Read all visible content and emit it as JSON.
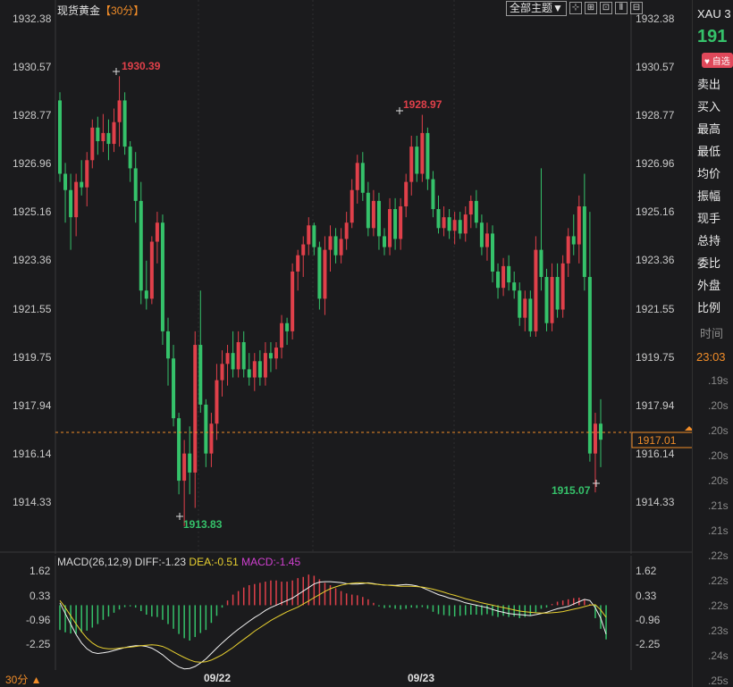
{
  "header": {
    "title": "现货黄金",
    "period": "【30分】",
    "theme_button": "全部主题▼",
    "tool_buttons": [
      "⊹",
      "⊞",
      "⊡",
      "Ⅱ",
      "⊟"
    ]
  },
  "price_axis": {
    "ticks": [
      "1932.38",
      "1930.57",
      "1928.77",
      "1926.96",
      "1925.16",
      "1923.36",
      "1921.55",
      "1919.75",
      "1917.94",
      "1916.14",
      "1914.33"
    ]
  },
  "current_price": "1917.01",
  "annotations": {
    "high1": "1930.39",
    "high2": "1928.97",
    "low1": "1913.83",
    "low2": "1915.07"
  },
  "macd": {
    "name": "MACD(26,12,9)",
    "diff": "DIFF:-1.23",
    "dea": "DEA:-0.51",
    "macd": "MACD:-1.45",
    "ticks": [
      "1.62",
      "0.33",
      "-0.96",
      "-2.25"
    ]
  },
  "x_axis": {
    "dates": [
      "09/22",
      "09/23"
    ]
  },
  "footer": {
    "period": "30分 ▲"
  },
  "sidebar": {
    "symbol": "XAU 3",
    "price": "191",
    "badge": "♥ 自选",
    "items": [
      "卖出",
      "买入",
      "最高",
      "最低",
      "均价",
      "振幅",
      "现手",
      "总持",
      "委比",
      "外盘",
      "比例"
    ],
    "time_label": "时间",
    "time_value": "23:03",
    "ticks": [
      ".19s",
      ".20s",
      ".20s",
      ".20s",
      ".20s",
      ".21s",
      ".21s",
      ".22s",
      ".22s",
      ".22s",
      ".23s",
      ".24s",
      ".25s"
    ]
  },
  "colors": {
    "up": "#e0404a",
    "down": "#35c26a",
    "background": "#1b1b1d",
    "accent": "#f08c28",
    "dea": "#e8d030",
    "macd_label": "#d040d0"
  },
  "chart_data": {
    "type": "candlestick",
    "price_range": [
      1913.2,
      1933.0
    ],
    "candles": [
      {
        "o": 1929.5,
        "h": 1929.8,
        "l": 1926.5,
        "c": 1926.8
      },
      {
        "o": 1926.8,
        "h": 1927.2,
        "l": 1925.0,
        "c": 1926.2
      },
      {
        "o": 1926.2,
        "h": 1926.8,
        "l": 1924.0,
        "c": 1925.2
      },
      {
        "o": 1925.2,
        "h": 1926.8,
        "l": 1924.5,
        "c": 1926.5
      },
      {
        "o": 1926.5,
        "h": 1927.3,
        "l": 1926.0,
        "c": 1926.3
      },
      {
        "o": 1926.3,
        "h": 1927.6,
        "l": 1925.6,
        "c": 1927.3
      },
      {
        "o": 1927.3,
        "h": 1928.8,
        "l": 1927.0,
        "c": 1928.5
      },
      {
        "o": 1928.5,
        "h": 1928.9,
        "l": 1927.5,
        "c": 1928.0
      },
      {
        "o": 1928.0,
        "h": 1929.0,
        "l": 1927.6,
        "c": 1928.3
      },
      {
        "o": 1928.3,
        "h": 1928.8,
        "l": 1927.3,
        "c": 1927.9
      },
      {
        "o": 1927.9,
        "h": 1929.2,
        "l": 1927.6,
        "c": 1928.7
      },
      {
        "o": 1928.7,
        "h": 1930.39,
        "l": 1927.8,
        "c": 1929.5
      },
      {
        "o": 1929.5,
        "h": 1929.8,
        "l": 1927.5,
        "c": 1927.8
      },
      {
        "o": 1927.8,
        "h": 1928.0,
        "l": 1926.5,
        "c": 1927.0
      },
      {
        "o": 1927.0,
        "h": 1927.6,
        "l": 1925.0,
        "c": 1925.8
      },
      {
        "o": 1925.8,
        "h": 1926.5,
        "l": 1922.0,
        "c": 1922.5
      },
      {
        "o": 1922.5,
        "h": 1923.6,
        "l": 1921.8,
        "c": 1922.2
      },
      {
        "o": 1922.2,
        "h": 1924.5,
        "l": 1922.0,
        "c": 1924.3
      },
      {
        "o": 1924.3,
        "h": 1925.4,
        "l": 1923.5,
        "c": 1925.0
      },
      {
        "o": 1925.0,
        "h": 1925.3,
        "l": 1920.5,
        "c": 1921.0
      },
      {
        "o": 1921.0,
        "h": 1921.5,
        "l": 1919.0,
        "c": 1920.0
      },
      {
        "o": 1920.0,
        "h": 1920.5,
        "l": 1917.5,
        "c": 1917.8
      },
      {
        "o": 1917.8,
        "h": 1918.0,
        "l": 1915.0,
        "c": 1915.5
      },
      {
        "o": 1915.5,
        "h": 1917.0,
        "l": 1913.83,
        "c": 1916.5
      },
      {
        "o": 1916.5,
        "h": 1917.5,
        "l": 1915.0,
        "c": 1915.8
      },
      {
        "o": 1915.8,
        "h": 1921.0,
        "l": 1914.5,
        "c": 1920.5
      },
      {
        "o": 1920.5,
        "h": 1922.5,
        "l": 1918.0,
        "c": 1918.3
      },
      {
        "o": 1918.3,
        "h": 1918.5,
        "l": 1916.0,
        "c": 1916.5
      },
      {
        "o": 1916.5,
        "h": 1918.0,
        "l": 1916.0,
        "c": 1917.6
      },
      {
        "o": 1917.6,
        "h": 1919.8,
        "l": 1917.0,
        "c": 1919.2
      },
      {
        "o": 1919.2,
        "h": 1920.3,
        "l": 1918.6,
        "c": 1919.8
      },
      {
        "o": 1919.8,
        "h": 1920.5,
        "l": 1919.0,
        "c": 1920.2
      },
      {
        "o": 1920.2,
        "h": 1921.0,
        "l": 1919.3,
        "c": 1919.6
      },
      {
        "o": 1919.6,
        "h": 1921.0,
        "l": 1919.3,
        "c": 1920.6
      },
      {
        "o": 1920.6,
        "h": 1921.0,
        "l": 1919.3,
        "c": 1919.6
      },
      {
        "o": 1919.6,
        "h": 1920.2,
        "l": 1919.0,
        "c": 1919.3
      },
      {
        "o": 1919.3,
        "h": 1920.2,
        "l": 1918.8,
        "c": 1919.9
      },
      {
        "o": 1919.9,
        "h": 1920.3,
        "l": 1919.0,
        "c": 1919.3
      },
      {
        "o": 1919.3,
        "h": 1920.6,
        "l": 1919.0,
        "c": 1920.2
      },
      {
        "o": 1920.2,
        "h": 1920.6,
        "l": 1919.5,
        "c": 1920.0
      },
      {
        "o": 1920.0,
        "h": 1920.6,
        "l": 1919.6,
        "c": 1920.4
      },
      {
        "o": 1920.4,
        "h": 1921.6,
        "l": 1920.0,
        "c": 1921.3
      },
      {
        "o": 1921.3,
        "h": 1921.5,
        "l": 1920.5,
        "c": 1921.0
      },
      {
        "o": 1921.0,
        "h": 1923.5,
        "l": 1920.7,
        "c": 1923.2
      },
      {
        "o": 1923.2,
        "h": 1924.0,
        "l": 1922.5,
        "c": 1923.8
      },
      {
        "o": 1923.8,
        "h": 1924.5,
        "l": 1923.0,
        "c": 1924.2
      },
      {
        "o": 1924.2,
        "h": 1925.2,
        "l": 1923.8,
        "c": 1924.9
      },
      {
        "o": 1924.9,
        "h": 1925.0,
        "l": 1923.8,
        "c": 1924.1
      },
      {
        "o": 1924.1,
        "h": 1924.3,
        "l": 1921.8,
        "c": 1922.2
      },
      {
        "o": 1922.2,
        "h": 1924.5,
        "l": 1921.6,
        "c": 1924.0
      },
      {
        "o": 1924.0,
        "h": 1924.9,
        "l": 1923.2,
        "c": 1924.5
      },
      {
        "o": 1924.5,
        "h": 1924.8,
        "l": 1923.5,
        "c": 1923.8
      },
      {
        "o": 1923.8,
        "h": 1924.8,
        "l": 1923.5,
        "c": 1924.4
      },
      {
        "o": 1924.4,
        "h": 1925.4,
        "l": 1924.0,
        "c": 1925.0
      },
      {
        "o": 1925.0,
        "h": 1926.6,
        "l": 1924.8,
        "c": 1926.2
      },
      {
        "o": 1926.2,
        "h": 1927.5,
        "l": 1925.7,
        "c": 1927.2
      },
      {
        "o": 1927.2,
        "h": 1927.6,
        "l": 1925.8,
        "c": 1926.1
      },
      {
        "o": 1926.1,
        "h": 1926.5,
        "l": 1924.5,
        "c": 1924.8
      },
      {
        "o": 1924.8,
        "h": 1926.2,
        "l": 1924.5,
        "c": 1925.8
      },
      {
        "o": 1925.8,
        "h": 1926.1,
        "l": 1924.0,
        "c": 1924.5
      },
      {
        "o": 1924.5,
        "h": 1924.8,
        "l": 1923.8,
        "c": 1924.1
      },
      {
        "o": 1924.1,
        "h": 1925.9,
        "l": 1923.8,
        "c": 1925.5
      },
      {
        "o": 1925.5,
        "h": 1925.9,
        "l": 1924.0,
        "c": 1924.4
      },
      {
        "o": 1924.4,
        "h": 1925.9,
        "l": 1924.0,
        "c": 1925.6
      },
      {
        "o": 1925.6,
        "h": 1926.8,
        "l": 1925.2,
        "c": 1926.5
      },
      {
        "o": 1926.5,
        "h": 1928.2,
        "l": 1926.0,
        "c": 1927.8
      },
      {
        "o": 1927.8,
        "h": 1928.2,
        "l": 1926.5,
        "c": 1926.8
      },
      {
        "o": 1926.8,
        "h": 1928.97,
        "l": 1926.5,
        "c": 1928.3
      },
      {
        "o": 1928.3,
        "h": 1928.5,
        "l": 1926.2,
        "c": 1926.6
      },
      {
        "o": 1926.6,
        "h": 1926.9,
        "l": 1925.2,
        "c": 1925.5
      },
      {
        "o": 1925.5,
        "h": 1926.0,
        "l": 1924.6,
        "c": 1924.8
      },
      {
        "o": 1924.8,
        "h": 1925.6,
        "l": 1924.5,
        "c": 1925.2
      },
      {
        "o": 1925.2,
        "h": 1925.5,
        "l": 1924.4,
        "c": 1924.7
      },
      {
        "o": 1924.7,
        "h": 1925.4,
        "l": 1924.2,
        "c": 1925.1
      },
      {
        "o": 1925.1,
        "h": 1925.4,
        "l": 1924.4,
        "c": 1924.6
      },
      {
        "o": 1924.6,
        "h": 1925.6,
        "l": 1924.3,
        "c": 1925.3
      },
      {
        "o": 1925.3,
        "h": 1926.0,
        "l": 1924.8,
        "c": 1925.8
      },
      {
        "o": 1925.8,
        "h": 1926.2,
        "l": 1924.8,
        "c": 1925.0
      },
      {
        "o": 1925.0,
        "h": 1925.3,
        "l": 1923.8,
        "c": 1924.1
      },
      {
        "o": 1924.1,
        "h": 1925.0,
        "l": 1923.6,
        "c": 1924.6
      },
      {
        "o": 1924.6,
        "h": 1924.9,
        "l": 1922.8,
        "c": 1923.2
      },
      {
        "o": 1923.2,
        "h": 1923.5,
        "l": 1922.2,
        "c": 1922.6
      },
      {
        "o": 1922.6,
        "h": 1923.7,
        "l": 1922.3,
        "c": 1923.4
      },
      {
        "o": 1923.4,
        "h": 1923.8,
        "l": 1922.5,
        "c": 1922.8
      },
      {
        "o": 1922.8,
        "h": 1923.2,
        "l": 1922.2,
        "c": 1922.5
      },
      {
        "o": 1922.5,
        "h": 1922.8,
        "l": 1921.2,
        "c": 1921.5
      },
      {
        "o": 1921.5,
        "h": 1922.5,
        "l": 1921.0,
        "c": 1922.2
      },
      {
        "o": 1922.2,
        "h": 1922.5,
        "l": 1920.8,
        "c": 1921.0
      },
      {
        "o": 1921.0,
        "h": 1924.5,
        "l": 1920.8,
        "c": 1924.0
      },
      {
        "o": 1924.0,
        "h": 1927.0,
        "l": 1922.5,
        "c": 1923.0
      },
      {
        "o": 1923.0,
        "h": 1923.3,
        "l": 1921.0,
        "c": 1921.3
      },
      {
        "o": 1921.3,
        "h": 1923.5,
        "l": 1921.0,
        "c": 1923.0
      },
      {
        "o": 1923.0,
        "h": 1923.5,
        "l": 1921.5,
        "c": 1921.8
      },
      {
        "o": 1921.8,
        "h": 1923.8,
        "l": 1921.5,
        "c": 1923.5
      },
      {
        "o": 1923.5,
        "h": 1924.8,
        "l": 1923.0,
        "c": 1924.5
      },
      {
        "o": 1924.5,
        "h": 1925.3,
        "l": 1923.8,
        "c": 1924.2
      },
      {
        "o": 1924.2,
        "h": 1926.0,
        "l": 1923.5,
        "c": 1925.6
      },
      {
        "o": 1925.6,
        "h": 1926.8,
        "l": 1922.5,
        "c": 1923.0
      },
      {
        "o": 1923.0,
        "h": 1925.4,
        "l": 1916.2,
        "c": 1916.5
      },
      {
        "o": 1916.5,
        "h": 1918.0,
        "l": 1915.07,
        "c": 1917.6
      },
      {
        "o": 1917.6,
        "h": 1918.5,
        "l": 1916.0,
        "c": 1917.01
      }
    ],
    "macd_range": [
      -2.75,
      1.95
    ],
    "macd_hist": [
      -1.05,
      -1.15,
      -1.2,
      -1.22,
      -1.15,
      -1.08,
      -0.95,
      -0.8,
      -0.62,
      -0.48,
      -0.32,
      -0.18,
      -0.08,
      -0.05,
      -0.1,
      -0.25,
      -0.4,
      -0.48,
      -0.5,
      -0.62,
      -0.8,
      -1.0,
      -1.22,
      -1.4,
      -1.5,
      -1.35,
      -1.18,
      -1.05,
      -0.75,
      -0.45,
      -0.1,
      0.2,
      0.45,
      0.6,
      0.75,
      0.85,
      0.9,
      0.95,
      1.0,
      1.05,
      1.05,
      1.0,
      1.0,
      1.05,
      1.15,
      1.2,
      1.3,
      1.25,
      1.1,
      0.95,
      0.85,
      0.72,
      0.6,
      0.5,
      0.45,
      0.42,
      0.35,
      0.25,
      0.1,
      -0.05,
      -0.12,
      -0.1,
      -0.15,
      -0.18,
      -0.15,
      -0.1,
      -0.12,
      -0.08,
      -0.15,
      -0.28,
      -0.38,
      -0.42,
      -0.45,
      -0.48,
      -0.45,
      -0.42,
      -0.4,
      -0.4,
      -0.42,
      -0.38,
      -0.45,
      -0.5,
      -0.45,
      -0.5,
      -0.48,
      -0.55,
      -0.5,
      -0.45,
      -0.3,
      -0.15,
      -0.1,
      0.05,
      0.15,
      0.2,
      0.25,
      0.3,
      0.32,
      0.25,
      0.05,
      -0.55,
      -1.0,
      -1.45
    ],
    "diff": [
      0.1,
      -0.35,
      -0.8,
      -1.25,
      -1.6,
      -1.85,
      -2.0,
      -2.05,
      -2.02,
      -1.98,
      -1.92,
      -1.86,
      -1.8,
      -1.75,
      -1.72,
      -1.72,
      -1.75,
      -1.82,
      -1.95,
      -2.1,
      -2.3,
      -2.48,
      -2.62,
      -2.7,
      -2.68,
      -2.6,
      -2.45,
      -2.28,
      -2.05,
      -1.82,
      -1.6,
      -1.4,
      -1.2,
      -1.02,
      -0.85,
      -0.68,
      -0.52,
      -0.38,
      -0.22,
      -0.1,
      0.0,
      0.1,
      0.2,
      0.3,
      0.45,
      0.6,
      0.75,
      0.9,
      0.98,
      1.0,
      1.0,
      0.98,
      0.96,
      0.92,
      0.9,
      0.9,
      0.92,
      0.95,
      0.92,
      0.88,
      0.85,
      0.85,
      0.84,
      0.86,
      0.88,
      0.86,
      0.82,
      0.75,
      0.65,
      0.55,
      0.45,
      0.38,
      0.3,
      0.25,
      0.18,
      0.1,
      0.05,
      0.0,
      -0.05,
      -0.1,
      -0.18,
      -0.25,
      -0.3,
      -0.35,
      -0.38,
      -0.4,
      -0.42,
      -0.44,
      -0.4,
      -0.35,
      -0.3,
      -0.22,
      -0.15,
      -0.1,
      -0.05,
      0.05,
      0.15,
      0.25,
      0.2,
      -0.1,
      -0.55,
      -1.23
    ],
    "dea": [
      0.2,
      -0.1,
      -0.45,
      -0.8,
      -1.12,
      -1.4,
      -1.6,
      -1.75,
      -1.82,
      -1.85,
      -1.85,
      -1.82,
      -1.8,
      -1.78,
      -1.75,
      -1.72,
      -1.7,
      -1.68,
      -1.7,
      -1.75,
      -1.85,
      -1.98,
      -2.1,
      -2.22,
      -2.32,
      -2.4,
      -2.42,
      -2.4,
      -2.33,
      -2.22,
      -2.1,
      -1.95,
      -1.8,
      -1.62,
      -1.45,
      -1.28,
      -1.1,
      -0.95,
      -0.8,
      -0.65,
      -0.52,
      -0.4,
      -0.28,
      -0.18,
      -0.08,
      0.05,
      0.18,
      0.32,
      0.45,
      0.58,
      0.7,
      0.78,
      0.85,
      0.9,
      0.93,
      0.95,
      0.95,
      0.93,
      0.9,
      0.88,
      0.86,
      0.84,
      0.82,
      0.8,
      0.8,
      0.8,
      0.79,
      0.77,
      0.73,
      0.68,
      0.62,
      0.55,
      0.48,
      0.42,
      0.35,
      0.28,
      0.22,
      0.16,
      0.1,
      0.05,
      0.0,
      -0.05,
      -0.1,
      -0.15,
      -0.2,
      -0.25,
      -0.28,
      -0.3,
      -0.32,
      -0.33,
      -0.33,
      -0.32,
      -0.3,
      -0.27,
      -0.22,
      -0.17,
      -0.12,
      -0.06,
      0.0,
      0.02,
      -0.2,
      -0.51
    ]
  }
}
